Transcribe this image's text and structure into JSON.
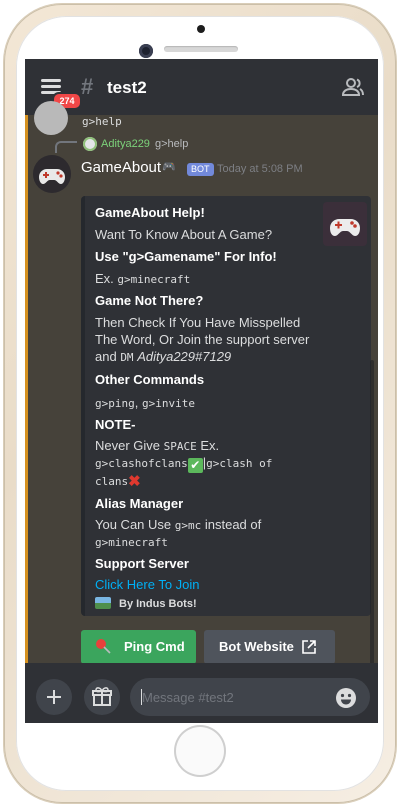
{
  "header": {
    "notification_count": "274",
    "channel_hash": "#",
    "channel_name": "test2"
  },
  "previous_message": {
    "text": "g>help"
  },
  "reply": {
    "username": "Aditya229",
    "text": "g>help"
  },
  "message": {
    "username": "GameAbout",
    "username_emoji": "🎮",
    "bot_tag": "BOT",
    "timestamp": "Today at 5:08 PM"
  },
  "embed": {
    "title": "GameAbout Help!",
    "intro": "Want To Know About A Game?",
    "use_heading": "Use \"g>Gamename\" For Info!",
    "example_prefix": "Ex. ",
    "example_code": "g>minecraft",
    "not_there_heading": "Game Not There?",
    "not_there_line1": "Then Check If You Have Misspelled",
    "not_there_line2": "The Word, Or Join the support server",
    "not_there_line3_prefix": "and ",
    "not_there_dm": "DM",
    "not_there_handle": "Aditya229#7129",
    "other_heading": "Other Commands",
    "other_cmd1": "g>ping",
    "other_sep": ", ",
    "other_cmd2": "g>invite",
    "note_heading": "NOTE-",
    "note_line1_prefix": "Never Give ",
    "note_space": "SPACE",
    "note_line1_ex": " Ex.",
    "note_good": "g>clashofclans",
    "note_check": "✔",
    "note_pipe": "|",
    "note_bad1": "g>clash of",
    "note_bad2": "clans",
    "note_cross": "✖",
    "alias_heading": "Alias Manager",
    "alias_line1_prefix": "You Can Use ",
    "alias_short": "g>mc",
    "alias_line1_suffix": " instead of",
    "alias_long": "g>minecraft",
    "support_heading": "Support Server",
    "support_link": "Click Here To Join",
    "footer": "By Indus Bots!"
  },
  "buttons": {
    "ping_label": "Ping Cmd",
    "website_label": "Bot Website"
  },
  "composer": {
    "placeholder": "Message #test2"
  },
  "colors": {
    "accent_blurple": "#7289da",
    "ping_green": "#3ba55d",
    "link_blue": "#00aff4",
    "mention_bar": "#faa61a"
  }
}
